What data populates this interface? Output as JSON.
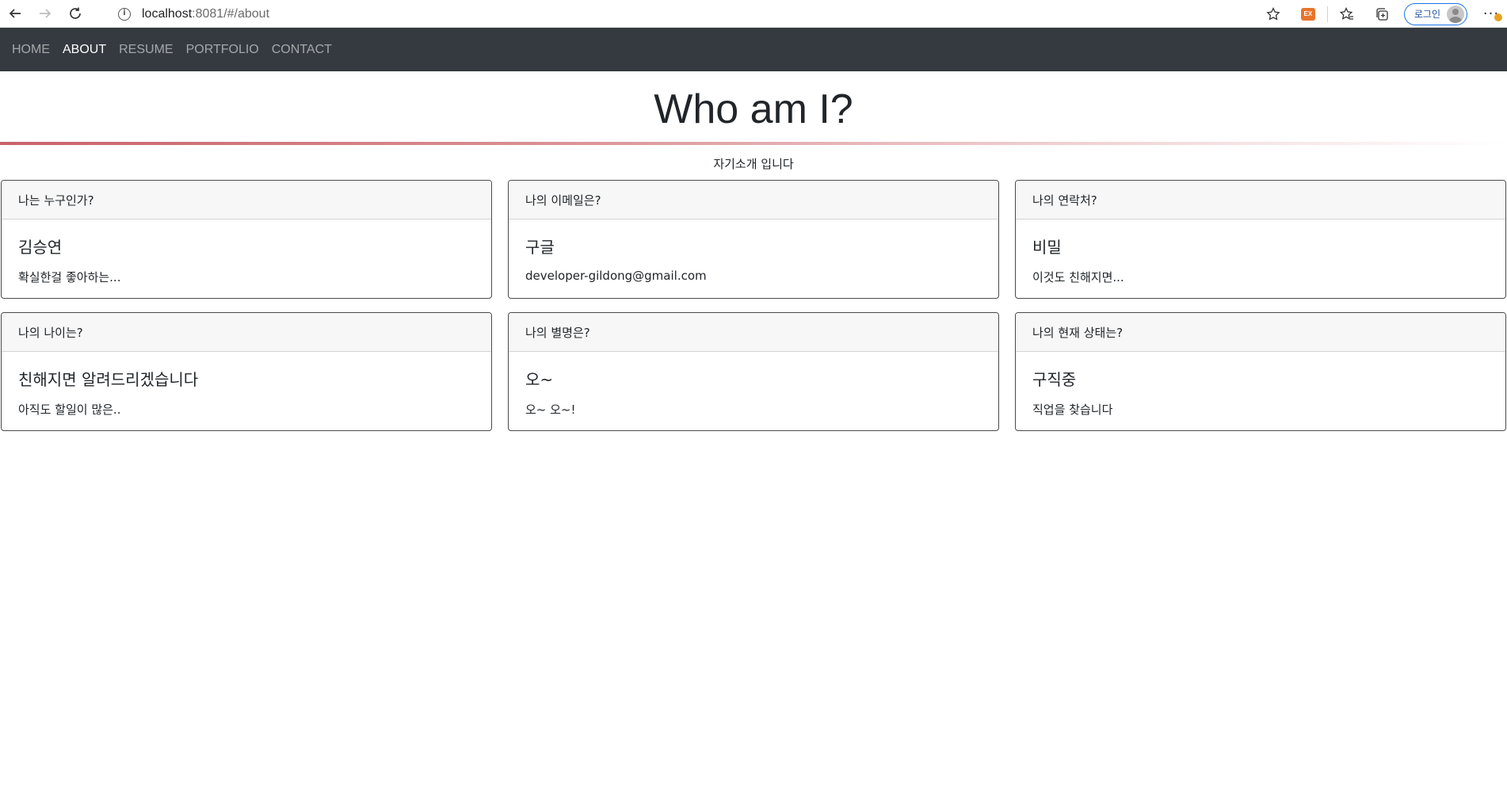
{
  "browser": {
    "url_host": "localhost",
    "url_path": ":8081/#/about",
    "login_label": "로그인",
    "extension_label": "EX"
  },
  "nav": {
    "items": [
      {
        "label": "HOME",
        "active": false
      },
      {
        "label": "ABOUT",
        "active": true
      },
      {
        "label": "RESUME",
        "active": false
      },
      {
        "label": "PORTFOLIO",
        "active": false
      },
      {
        "label": "CONTACT",
        "active": false
      }
    ]
  },
  "page": {
    "title": "Who am I?",
    "subtitle": "자기소개 입니다"
  },
  "cards": [
    {
      "header": "나는 누구인가?",
      "title": "김승연",
      "text": "확실한걸 좋아하는..."
    },
    {
      "header": "나의 이메일은?",
      "title": "구글",
      "text": "developer-gildong@gmail.com"
    },
    {
      "header": "나의 연락처?",
      "title": "비밀",
      "text": "이것도 친해지면..."
    },
    {
      "header": "나의 나이는?",
      "title": "친해지면 알려드리겠습니다",
      "text": "아직도 할일이 많은.."
    },
    {
      "header": "나의 별명은?",
      "title": "오~",
      "text": "오~ 오~!"
    },
    {
      "header": "나의 현재 상태는?",
      "title": "구직중",
      "text": "직업을 찾습니다"
    }
  ]
}
